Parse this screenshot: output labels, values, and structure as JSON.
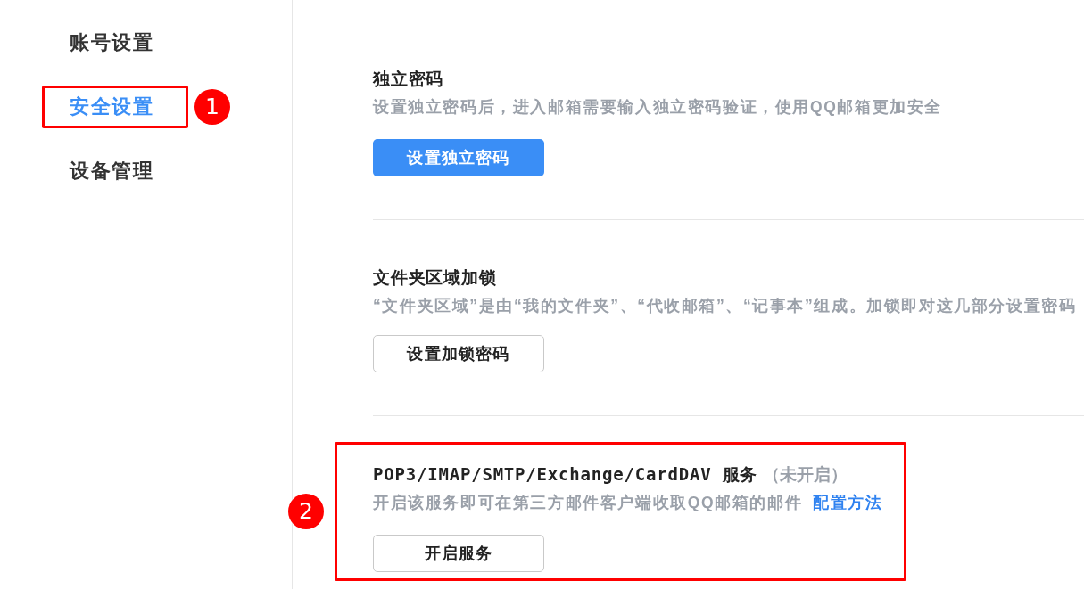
{
  "sidebar": {
    "items": [
      {
        "label": "账号设置",
        "selected": false
      },
      {
        "label": "安全设置",
        "selected": true,
        "annotation": "1"
      },
      {
        "label": "设备管理",
        "selected": false
      }
    ]
  },
  "sections": [
    {
      "title": "独立密码",
      "description": "设置独立密码后，进入邮箱需要输入独立密码验证，使用QQ邮箱更加安全",
      "button": {
        "label": "设置独立密码",
        "kind": "primary"
      }
    },
    {
      "title": "文件夹区域加锁",
      "description": "“文件夹区域”是由“我的文件夹”、“代收邮箱”、“记事本”组成。加锁即对这几部分设置密码",
      "button": {
        "label": "设置加锁密码",
        "kind": "secondary"
      }
    },
    {
      "title": "POP3/IMAP/SMTP/Exchange/CardDAV 服务",
      "status": "（未开启）",
      "description": "开启该服务即可在第三方邮件客户端收取QQ邮箱的邮件",
      "link": "配置方法",
      "button": {
        "label": "开启服务",
        "kind": "secondary"
      },
      "annotation": "2"
    }
  ]
}
